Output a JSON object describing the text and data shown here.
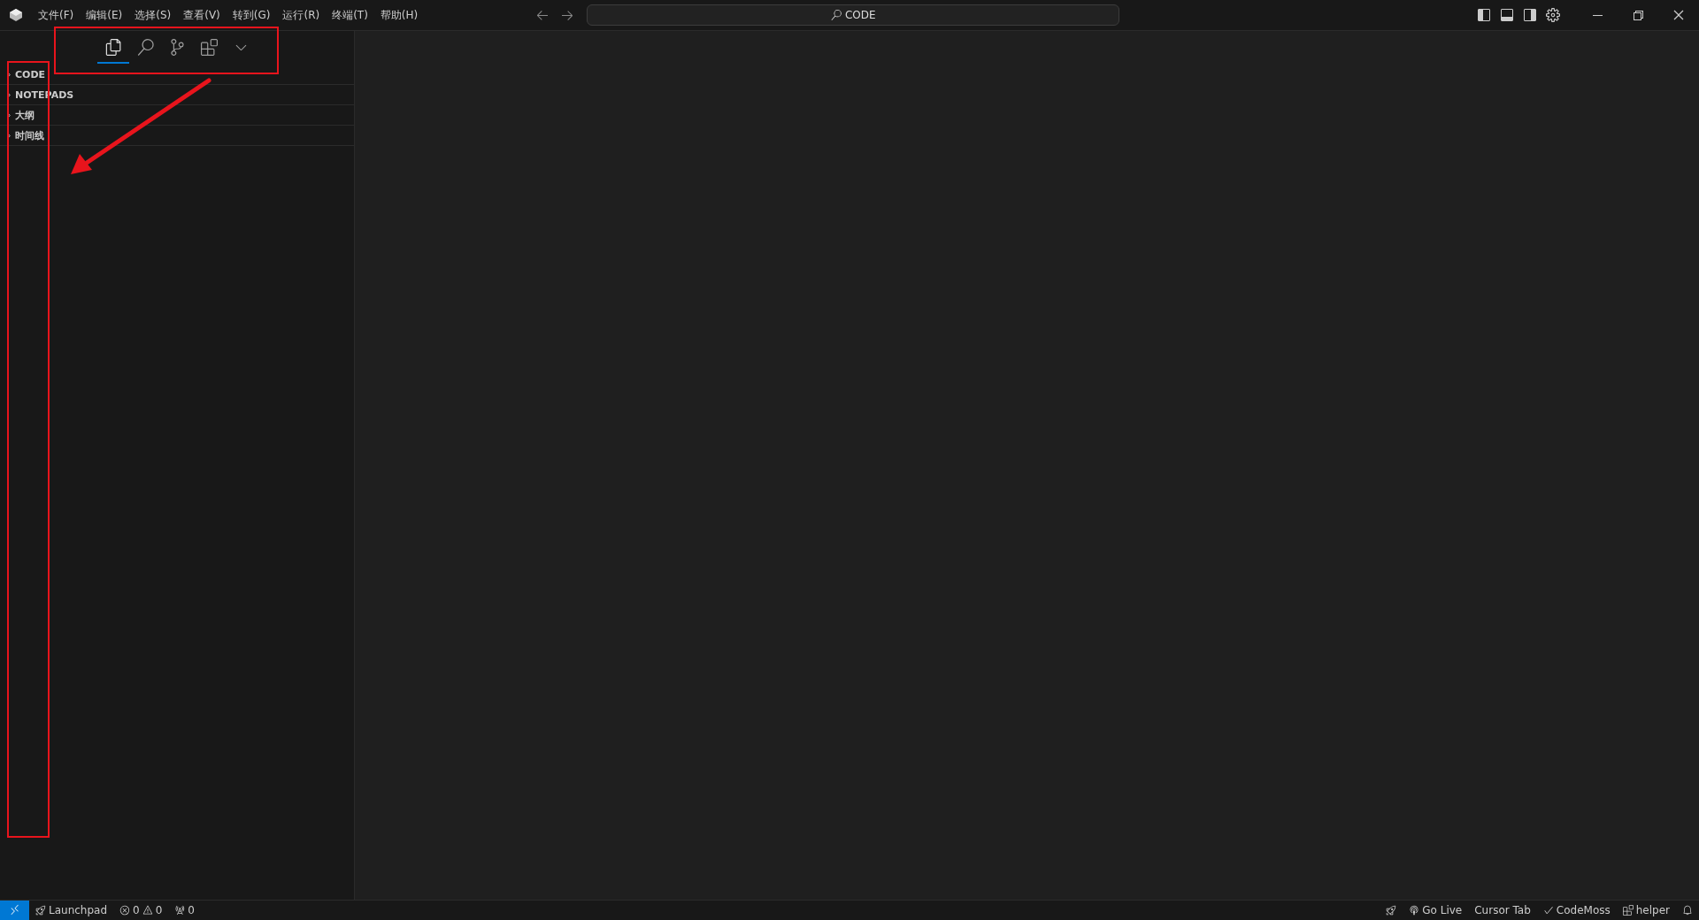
{
  "menu": [
    "文件(F)",
    "编辑(E)",
    "选择(S)",
    "查看(V)",
    "转到(G)",
    "运行(R)",
    "终端(T)",
    "帮助(H)"
  ],
  "command_center": {
    "text": "CODE"
  },
  "sidebar": {
    "tabs": [
      {
        "kind": "files",
        "selected": true
      },
      {
        "kind": "search",
        "selected": false
      },
      {
        "kind": "branch",
        "selected": false
      },
      {
        "kind": "extensions",
        "selected": false
      },
      {
        "kind": "more",
        "selected": false
      }
    ],
    "sections": [
      {
        "label": "CODE",
        "expanded": false
      },
      {
        "label": "NOTEPADS",
        "expanded": false
      },
      {
        "label": "大纲",
        "expanded": false
      },
      {
        "label": "时间线",
        "expanded": false
      }
    ]
  },
  "status_bar": {
    "left": [
      {
        "kind": "launchpad",
        "text": "Launchpad"
      },
      {
        "kind": "problems",
        "errors": "0",
        "warnings": "0"
      },
      {
        "kind": "ports",
        "text": "0"
      }
    ],
    "right": [
      {
        "kind": "golive",
        "text": "Go Live"
      },
      {
        "kind": "plain",
        "text": "Cursor Tab"
      },
      {
        "kind": "check",
        "text": "CodeMoss"
      },
      {
        "kind": "helper",
        "text": "helper"
      }
    ]
  }
}
